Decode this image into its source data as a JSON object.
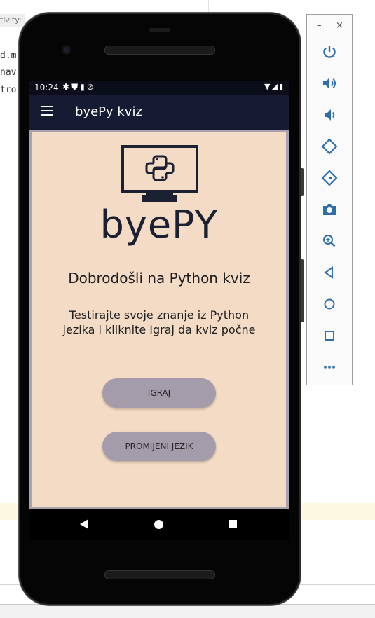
{
  "ide": {
    "tag_text": "tivity:",
    "code_lines": [
      "d.m",
      "nav(",
      "tro"
    ]
  },
  "phone": {
    "statusbar": {
      "time": "10:24",
      "left_icons": [
        "settings-icon",
        "shield-icon",
        "sd-card-icon",
        "no-sync-icon"
      ],
      "right_icons": [
        "wifi-icon",
        "signal-icon",
        "battery-icon"
      ]
    },
    "appbar": {
      "menu_icon": "hamburger-menu-icon",
      "title": "byePy kviz"
    },
    "main": {
      "logo_text": "byePY",
      "welcome": "Dobrodošli na Python kviz",
      "description": "Testirajte svoje znanje iz Python jezika i kliknite Igraj da kviz počne",
      "play_button": "IGRAJ",
      "language_button": "PROMIJENI JEZIK"
    },
    "navbar": {
      "icons": [
        "back-icon",
        "home-icon",
        "recents-icon"
      ]
    },
    "colors": {
      "appbar": "#161a33",
      "card_background": "#f3dbc5",
      "button": "#a59cab",
      "frame": "#a9a1ad"
    }
  },
  "toolbar": {
    "minimize": "–",
    "close": "×",
    "items": [
      "power-icon",
      "volume-up-icon",
      "volume-down-icon",
      "rotate-left-icon",
      "rotate-right-icon",
      "camera-icon",
      "zoom-icon",
      "back-icon",
      "home-icon",
      "overview-icon",
      "more-icon"
    ]
  }
}
